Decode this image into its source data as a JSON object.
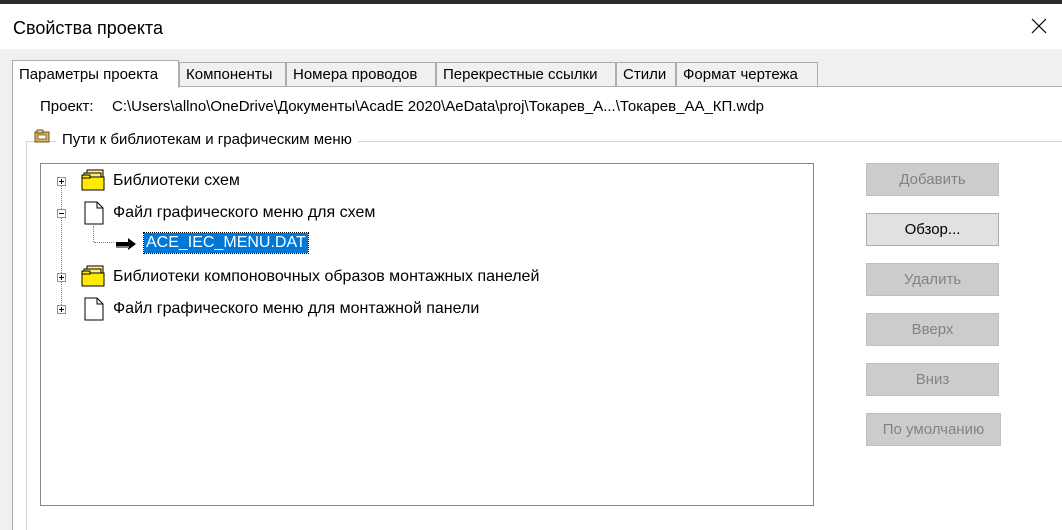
{
  "window": {
    "title": "Свойства проекта"
  },
  "tabs": [
    {
      "label": "Параметры проекта",
      "active": true
    },
    {
      "label": "Компоненты",
      "active": false
    },
    {
      "label": "Номера проводов",
      "active": false
    },
    {
      "label": "Перекрестные ссылки",
      "active": false
    },
    {
      "label": "Стили",
      "active": false
    },
    {
      "label": "Формат чертежа",
      "active": false
    }
  ],
  "project": {
    "label": "Проект:",
    "path": "C:\\Users\\allno\\OneDrive\\Документы\\AcadE 2020\\AeData\\proj\\Токарев_А...\\Токарев_АА_КП.wdp"
  },
  "group": {
    "title": "Пути к библиотекам и графическим меню"
  },
  "tree": {
    "items": [
      {
        "label": "Библиотеки схем",
        "icon": "folder-stack-icon",
        "expanded": false
      },
      {
        "label": "Файл графического меню для схем",
        "icon": "document-icon",
        "expanded": true
      },
      {
        "label": "ACE_IEC_MENU.DAT",
        "icon": "arrow-right-icon",
        "selected": true
      },
      {
        "label": "Библиотеки компоновочных образов монтажных панелей",
        "icon": "folder-stack-icon",
        "expanded": false
      },
      {
        "label": "Файл графического меню для монтажной панели",
        "icon": "document-icon",
        "expanded": false
      }
    ]
  },
  "buttons": {
    "add": {
      "label": "Добавить",
      "enabled": false
    },
    "browse": {
      "label": "Обзор...",
      "enabled": true
    },
    "delete": {
      "label": "Удалить",
      "enabled": false
    },
    "up": {
      "label": "Вверх",
      "enabled": false
    },
    "down": {
      "label": "Вниз",
      "enabled": false
    },
    "default": {
      "label": "По умолчанию",
      "enabled": false
    }
  }
}
